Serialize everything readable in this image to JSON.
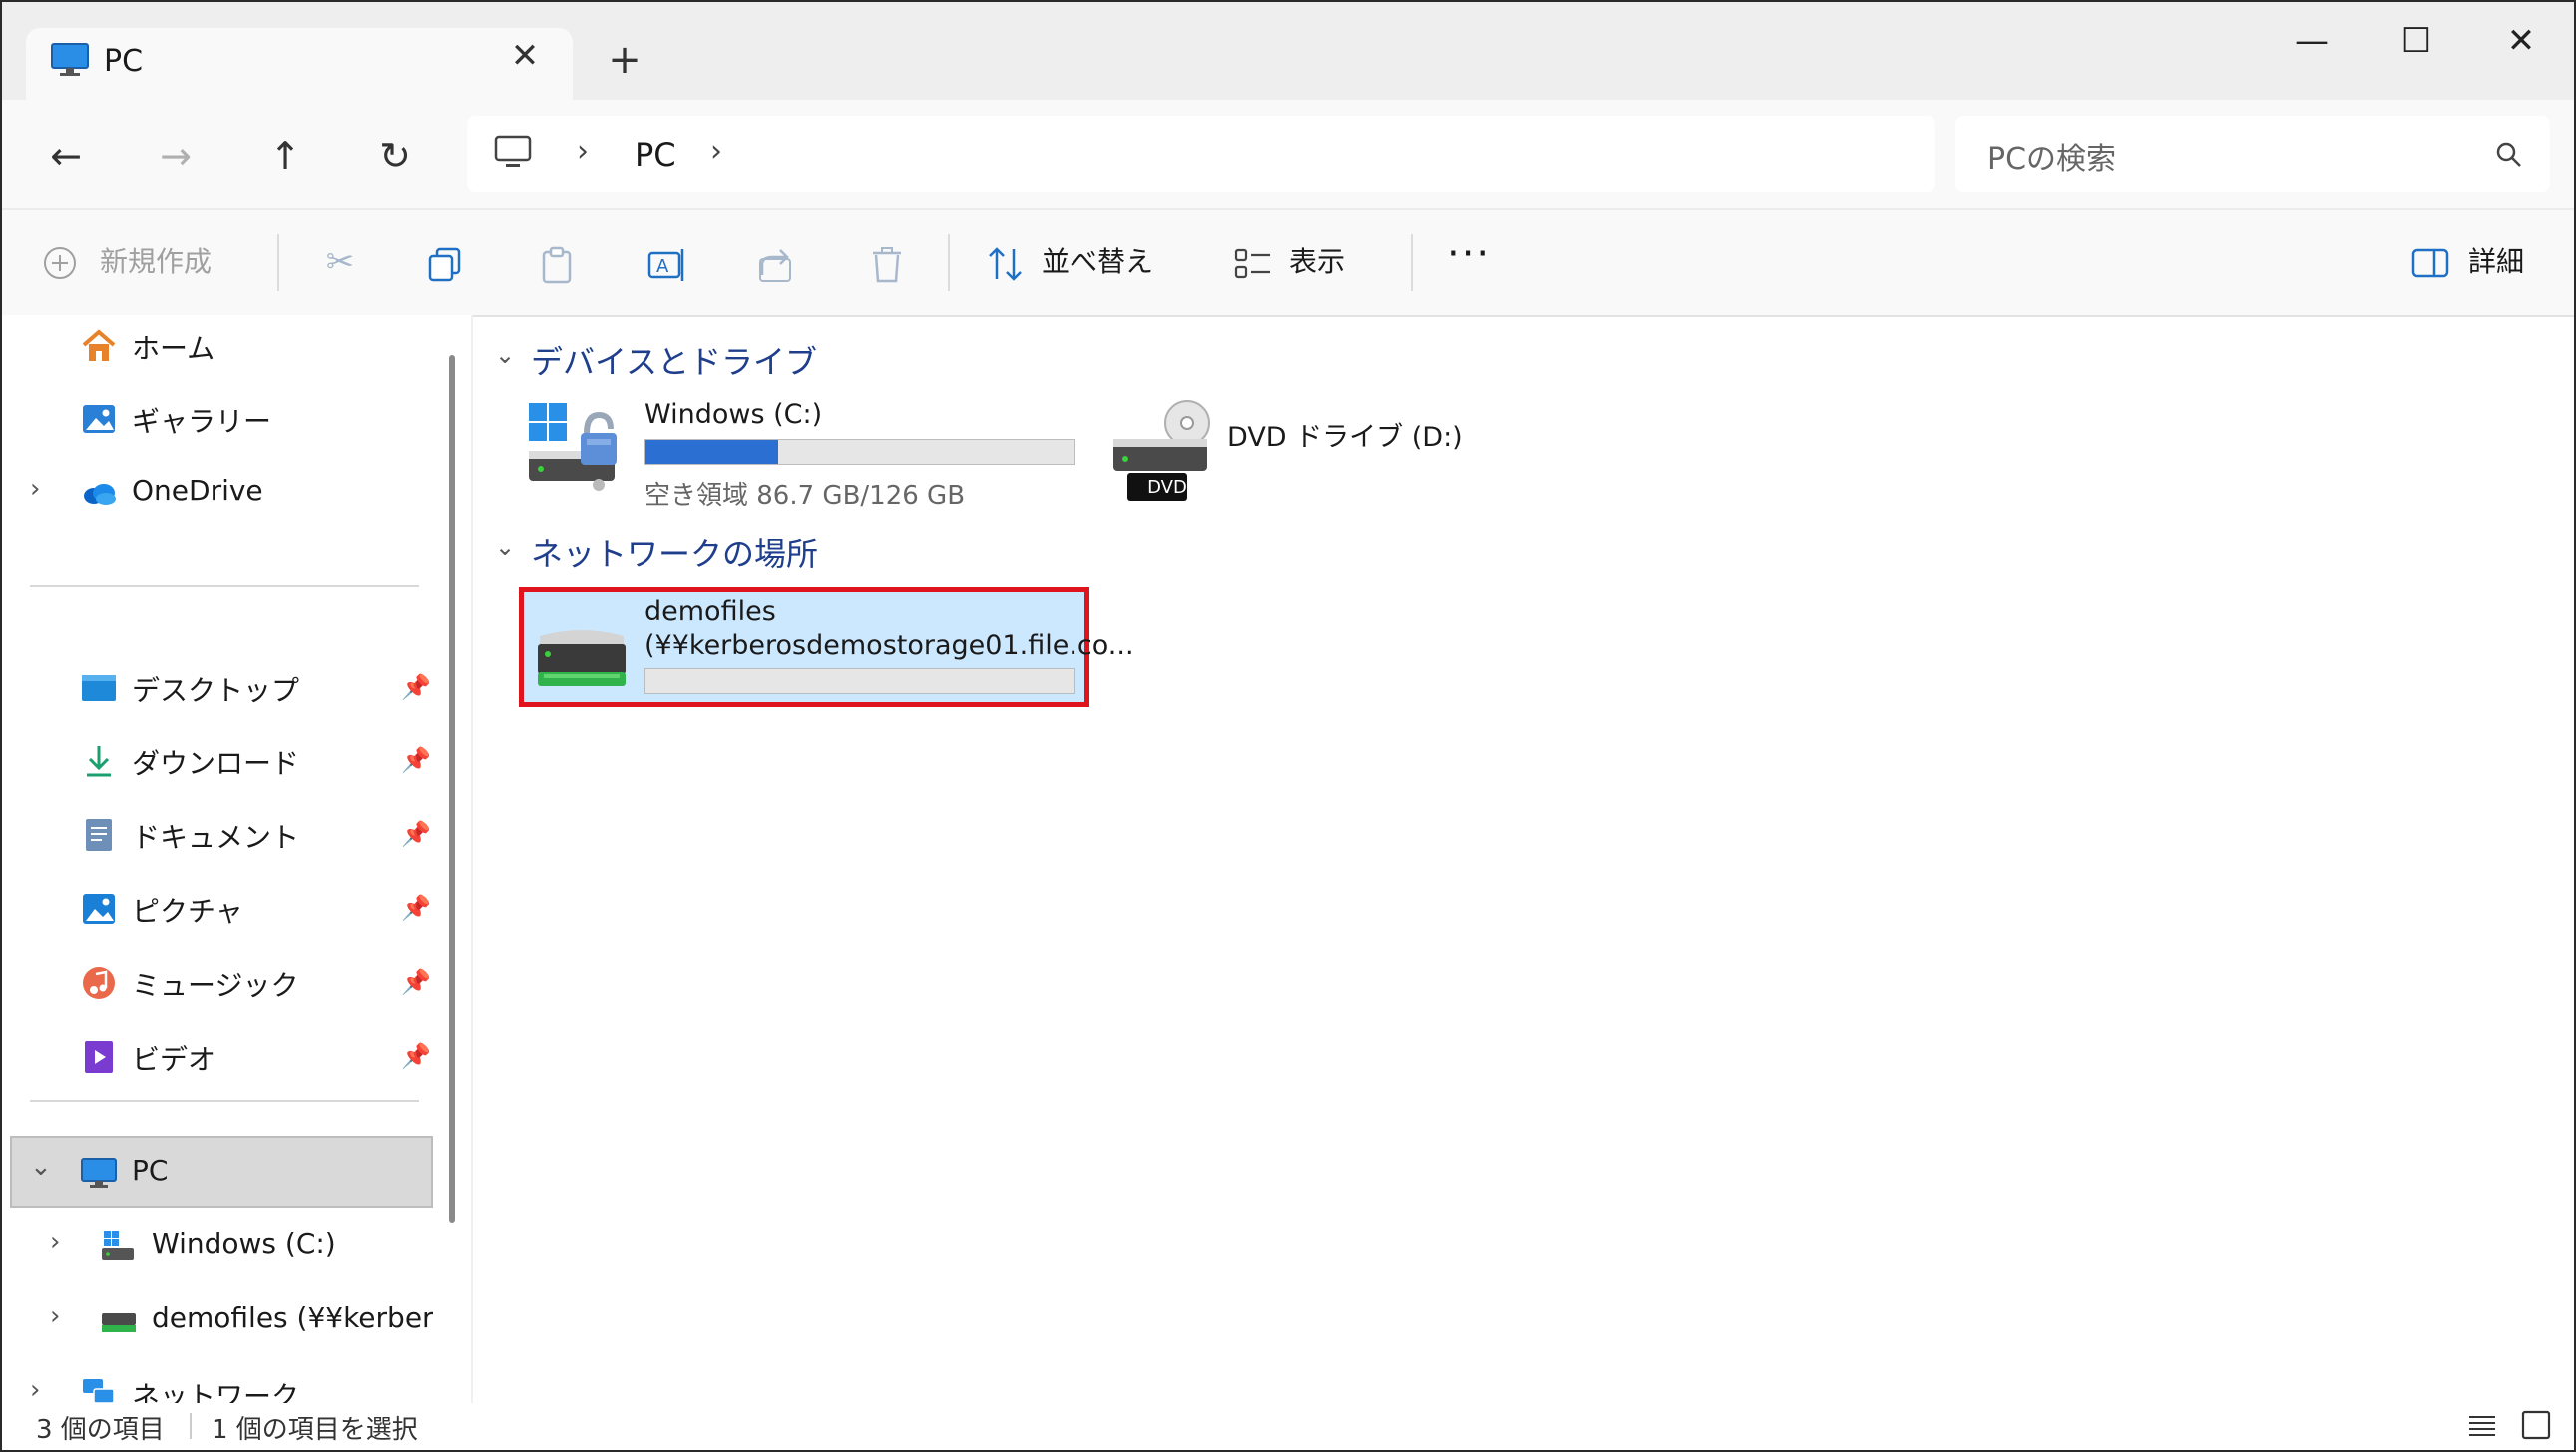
{
  "window": {
    "tab_title": "PC",
    "tab_close": "✕",
    "new_tab": "+",
    "minimize": "—",
    "maximize": "☐",
    "close": "✕"
  },
  "nav": {
    "back": "←",
    "forward": "→",
    "up": "↑",
    "refresh": "↻",
    "breadcrumb": [
      "PC"
    ],
    "search_placeholder": "PCの検索"
  },
  "toolbar": {
    "new_label": "新規作成",
    "sort_label": "並べ替え",
    "view_label": "表示",
    "more": "···",
    "details_label": "詳細"
  },
  "sidebar": {
    "top_items": [
      {
        "label": "ホーム",
        "icon": "home-icon"
      },
      {
        "label": "ギャラリー",
        "icon": "gallery-icon"
      },
      {
        "label": "OneDrive",
        "icon": "cloud-icon"
      }
    ],
    "quick_access": [
      {
        "label": "デスクトップ",
        "icon": "desktop-icon"
      },
      {
        "label": "ダウンロード",
        "icon": "download-icon"
      },
      {
        "label": "ドキュメント",
        "icon": "document-icon"
      },
      {
        "label": "ピクチャ",
        "icon": "pictures-icon"
      },
      {
        "label": "ミュージック",
        "icon": "music-icon"
      },
      {
        "label": "ビデオ",
        "icon": "video-icon"
      }
    ],
    "tree": [
      {
        "label": "PC",
        "icon": "pc-icon"
      },
      {
        "label": "Windows (C:)",
        "icon": "drive-icon"
      },
      {
        "label": "demofiles (¥¥kerberosde",
        "icon": "network-drive-icon"
      },
      {
        "label": "ネットワーク",
        "icon": "network-icon"
      }
    ]
  },
  "content": {
    "section_devices": "デバイスとドライブ",
    "section_network": "ネットワークの場所",
    "drive_c": {
      "name": "Windows (C:)",
      "free": "空き領域 86.7 GB/126 GB",
      "used_fraction": 0.31
    },
    "drive_d": {
      "name": "DVD ドライブ (D:)",
      "badge": "DVD"
    },
    "network_drive": {
      "name": "demofiles",
      "path": "(¥¥kerberosdemostorage01.file.co...",
      "used_fraction": 0
    }
  },
  "status": {
    "count": "3 個の項目",
    "selected": "1 個の項目を選択"
  },
  "colors": {
    "accent": "#1f6fc5",
    "selection": "#cce8ff",
    "highlight_border": "#e0141c"
  }
}
